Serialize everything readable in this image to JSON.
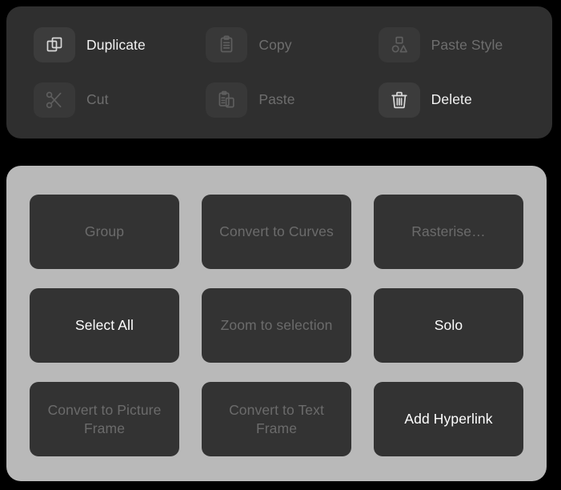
{
  "edit_actions": {
    "panel_background": "#2f2f2f",
    "items": [
      {
        "label": "Duplicate",
        "icon": "duplicate-icon",
        "enabled": true
      },
      {
        "label": "Copy",
        "icon": "clipboard-icon",
        "enabled": false
      },
      {
        "label": "Paste Style",
        "icon": "shapes-icon",
        "enabled": false
      },
      {
        "label": "Cut",
        "icon": "scissors-icon",
        "enabled": true
      },
      {
        "label": "Paste",
        "icon": "paste-icon",
        "enabled": false
      },
      {
        "label": "Delete",
        "icon": "trash-icon",
        "enabled": true
      }
    ]
  },
  "commands": {
    "panel_background": "#b9b9b9",
    "button_background": "#333333",
    "enabled_text_color": "#ffffff",
    "disabled_text_color": "#6b6b6b",
    "buttons": [
      {
        "label": "Group",
        "enabled": false
      },
      {
        "label": "Convert to Curves",
        "enabled": false
      },
      {
        "label": "Rasterise…",
        "enabled": false
      },
      {
        "label": "Select All",
        "enabled": true
      },
      {
        "label": "Zoom to selection",
        "enabled": false
      },
      {
        "label": "Solo",
        "enabled": true
      },
      {
        "label": "Convert to Picture Frame",
        "enabled": false
      },
      {
        "label": "Convert to Text Frame",
        "enabled": false
      },
      {
        "label": "Add Hyperlink",
        "enabled": true
      }
    ]
  }
}
